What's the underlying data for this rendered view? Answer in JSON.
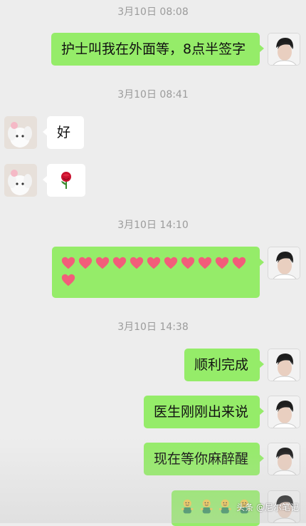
{
  "messages": {
    "ts1": "3月10日 08:08",
    "m1": "护士叫我在外面等，8点半签字",
    "ts2": "3月10日 08:41",
    "m2": "好",
    "m3_icon": "rose-icon",
    "ts3": "3月10日 14:10",
    "m4_icon": "heart-icon",
    "m4_count": 12,
    "ts4": "3月10日 14:38",
    "m5": "顺利完成",
    "m6": "医生刚刚出来说",
    "m7": "现在等你麻醉醒",
    "m8_icon": "doll-emoji-icon",
    "m8_count": 4
  },
  "watermark": "头条 @尼尔笔记",
  "colors": {
    "outgoing_bubble": "#95ec69",
    "incoming_bubble": "#ffffff",
    "background": "#ededed",
    "heart": "#f25d7a"
  }
}
